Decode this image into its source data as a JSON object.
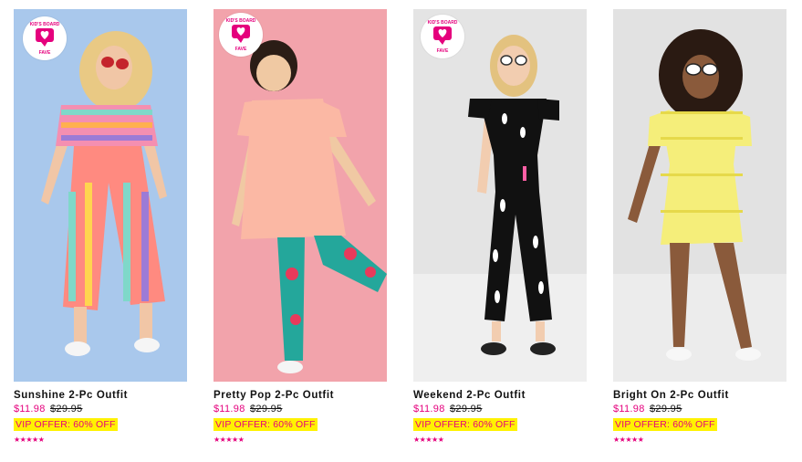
{
  "colors": {
    "accent": "#e5007d",
    "highlight": "#fff200",
    "text": "#111111"
  },
  "badge": {
    "icon": "heart-speech-bubble-icon",
    "line_top": "KID'S BOARD",
    "line_bottom": "FAVE"
  },
  "products": [
    {
      "name": "Sunshine 2-Pc Outfit",
      "sale_price": "$11.98",
      "original_price": "$29.95",
      "offer": "VIP OFFER: 60% OFF",
      "rating_stars": 5,
      "stars_text": "★★★★★",
      "has_badge": true,
      "background": "#a9c8ec"
    },
    {
      "name": "Pretty Pop 2-Pc Outfit",
      "sale_price": "$11.98",
      "original_price": "$29.95",
      "offer": "VIP OFFER: 60% OFF",
      "rating_stars": 5,
      "stars_text": "★★★★★",
      "has_badge": true,
      "background": "#f2a3ab"
    },
    {
      "name": "Weekend 2-Pc Outfit",
      "sale_price": "$11.98",
      "original_price": "$29.95",
      "offer": "VIP OFFER: 60% OFF",
      "rating_stars": 5,
      "stars_text": "★★★★★",
      "has_badge": true,
      "background": "#e4e4e4"
    },
    {
      "name": "Bright On 2-Pc Outfit",
      "sale_price": "$11.98",
      "original_price": "$29.95",
      "offer": "VIP OFFER: 60% OFF",
      "rating_stars": 5,
      "stars_text": "★★★★★",
      "has_badge": false,
      "background": "#e2e2e2"
    }
  ]
}
